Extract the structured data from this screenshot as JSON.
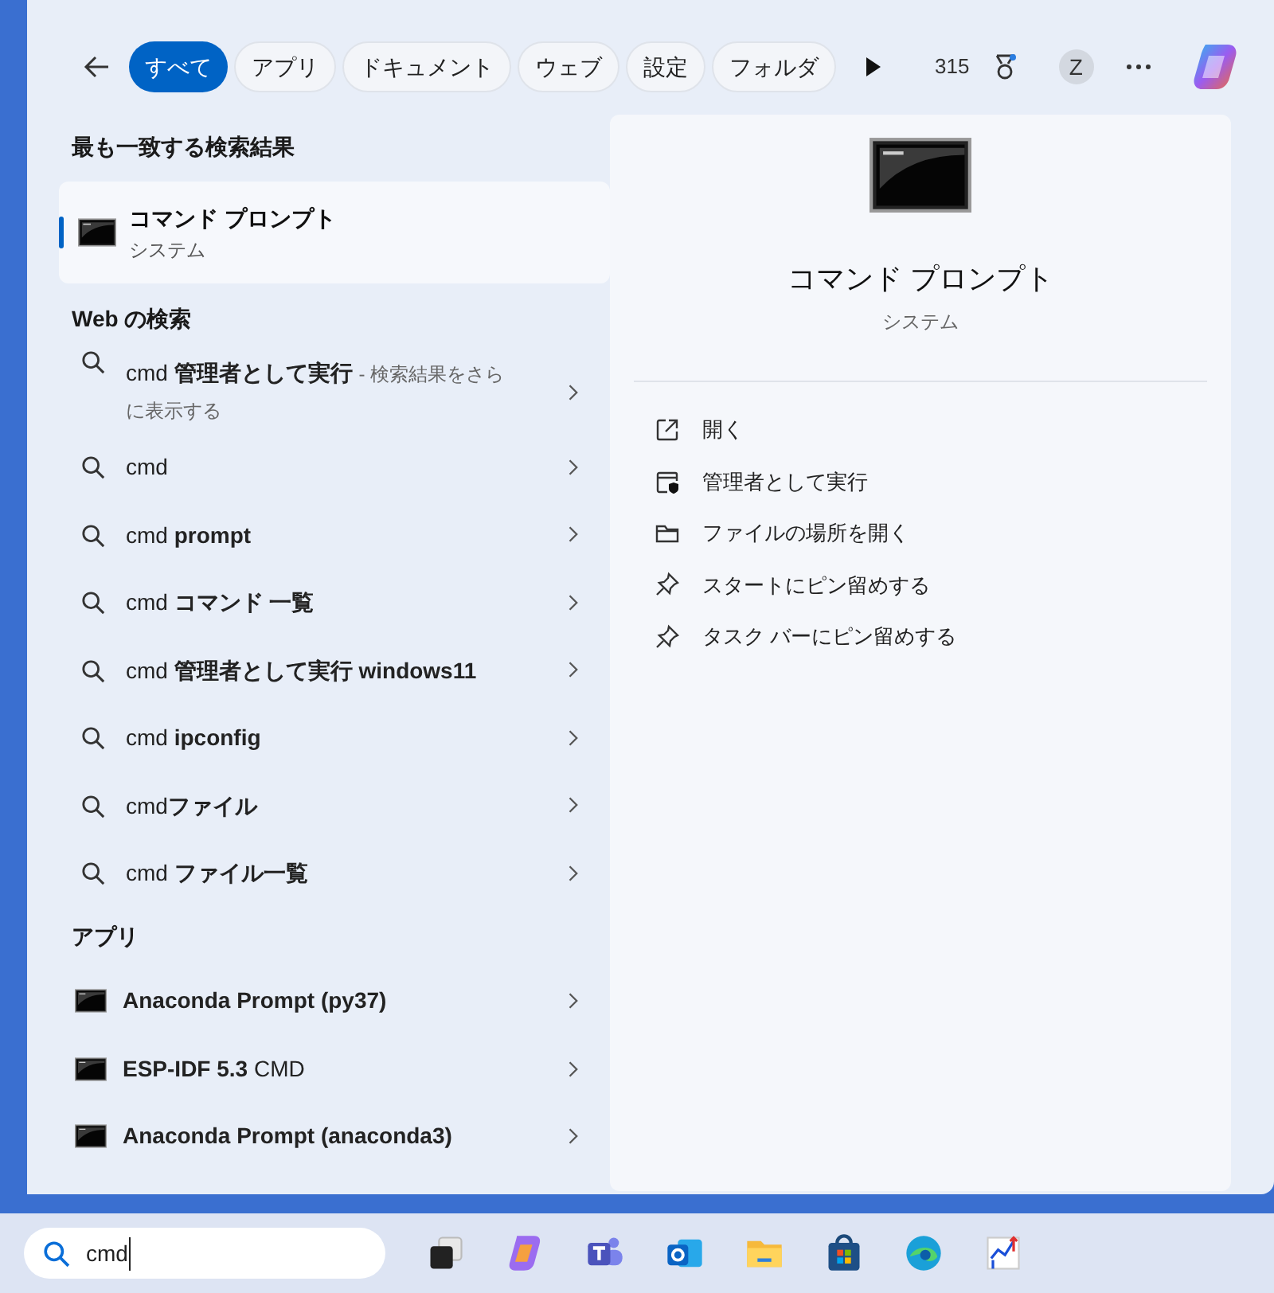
{
  "filters": [
    {
      "label": "すべて",
      "selected": true
    },
    {
      "label": "アプリ",
      "selected": false
    },
    {
      "label": "ドキュメント",
      "selected": false
    },
    {
      "label": "ウェブ",
      "selected": false
    },
    {
      "label": "設定",
      "selected": false
    },
    {
      "label": "フォルダ",
      "selected": false
    }
  ],
  "points": "315",
  "account_initial": "Z",
  "best_match": {
    "heading": "最も一致する検索結果",
    "title": "コマンド プロンプト",
    "subtitle": "システム",
    "selected": true
  },
  "web_search": {
    "heading": "Web の検索",
    "items": [
      {
        "text": "cmd **管理者として実行**",
        "suffix": "- 検索結果をさらに表示する"
      },
      {
        "text": "cmd"
      },
      {
        "text": "cmd **prompt**"
      },
      {
        "text": "cmd **コマンド 一覧**"
      },
      {
        "text": "cmd **管理者として実行 windows11**"
      },
      {
        "text": "cmd **ipconfig**"
      },
      {
        "text": "cmd**ファイル**"
      },
      {
        "text": "cmd **ファイル一覧**"
      }
    ]
  },
  "apps": {
    "heading": "アプリ",
    "items": [
      {
        "text": "**Anaconda Prompt (py37)**"
      },
      {
        "text": "**ESP-IDF 5.3** CMD"
      },
      {
        "text": "**Anaconda Prompt (anaconda3)**"
      }
    ]
  },
  "detail": {
    "title": "コマンド プロンプト",
    "subtitle": "システム",
    "actions": [
      {
        "kind": "open",
        "label": "開く"
      },
      {
        "kind": "admin",
        "label": "管理者として実行"
      },
      {
        "kind": "folder",
        "label": "ファイルの場所を開く"
      },
      {
        "kind": "pin",
        "label": "スタートにピン留めする"
      },
      {
        "kind": "pin",
        "label": "タスク バーにピン留めする"
      }
    ]
  },
  "taskbar": {
    "search_value": "cmd"
  }
}
